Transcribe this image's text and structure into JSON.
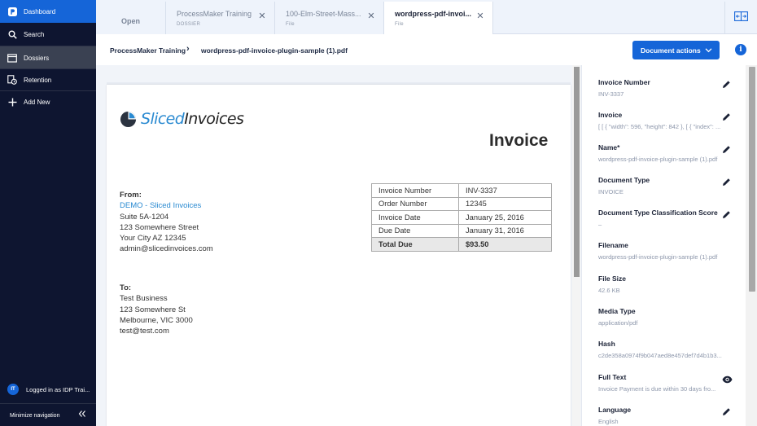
{
  "sidebar": {
    "items": [
      {
        "label": "Dashboard",
        "icon": "app-logo-icon"
      },
      {
        "label": "Search",
        "icon": "search-icon"
      },
      {
        "label": "Dossiers",
        "icon": "folder-icon"
      },
      {
        "label": "Retention",
        "icon": "retention-icon"
      },
      {
        "label": "Add New",
        "icon": "plus-icon"
      }
    ],
    "user_initials": "IT",
    "user_label": "Logged in as IDP Trai...",
    "minimize_label": "Minimize navigation"
  },
  "tabs": {
    "open_label": "Open",
    "items": [
      {
        "title": "ProcessMaker Training",
        "subtitle": "DOSSIER"
      },
      {
        "title": "100-Elm-Street-Mass...",
        "subtitle": "File"
      },
      {
        "title": "wordpress-pdf-invoi...",
        "subtitle": "File"
      }
    ]
  },
  "breadcrumb": {
    "parent": "ProcessMaker Training",
    "separator": "›",
    "current": "wordpress-pdf-invoice-plugin-sample (1).pdf"
  },
  "toolbar": {
    "document_actions_label": "Document actions",
    "info_glyph": "i"
  },
  "document": {
    "logo_word1": "Sliced",
    "logo_word2": "Invoices",
    "heading": "Invoice",
    "from_label": "From:",
    "from_name_demo": "DEMO",
    "from_name_rest": " - Sliced Invoices",
    "from_lines": [
      "Suite 5A-1204",
      "123 Somewhere Street",
      "Your City AZ 12345",
      "admin@slicedinvoices.com"
    ],
    "to_label": "To:",
    "to_lines": [
      "Test Business",
      "123 Somewhere St",
      "Melbourne, VIC 3000",
      "test@test.com"
    ],
    "table": [
      {
        "key": "Invoice Number",
        "value": "INV-3337"
      },
      {
        "key": "Order Number",
        "value": "12345"
      },
      {
        "key": "Invoice Date",
        "value": "January 25, 2016"
      },
      {
        "key": "Due Date",
        "value": "January 31, 2016"
      },
      {
        "key": "Total Due",
        "value": "$93.50"
      }
    ]
  },
  "properties": [
    {
      "label": "Invoice Number",
      "value": "INV-3337",
      "action": "pencil-icon"
    },
    {
      "label": "Invoice",
      "value": "[ [ { \"width\": 596, \"height\": 842 }, [ { \"index\": ...",
      "action": "pencil-icon"
    },
    {
      "label": "Name*",
      "value": "wordpress-pdf-invoice-plugin-sample (1).pdf",
      "action": "pencil-icon"
    },
    {
      "label": "Document Type",
      "value": "INVOICE",
      "action": "pencil-icon"
    },
    {
      "label": "Document Type Classification Score",
      "value": "–",
      "action": "pencil-icon"
    },
    {
      "label": "Filename",
      "value": "wordpress-pdf-invoice-plugin-sample (1).pdf",
      "action": ""
    },
    {
      "label": "File Size",
      "value": "42.6 KB",
      "action": ""
    },
    {
      "label": "Media Type",
      "value": "application/pdf",
      "action": ""
    },
    {
      "label": "Hash",
      "value": "c2de358a0974f9b047aed8e457def7d4b1b3...",
      "action": ""
    },
    {
      "label": "Full Text",
      "value": "Invoice Payment is due within 30 days fro...",
      "action": "eye-icon"
    },
    {
      "label": "Language",
      "value": "English",
      "action": "pencil-icon"
    }
  ],
  "colors": {
    "sidebar_bg": "#0e1530",
    "accent": "#1565d8",
    "logo_blue": "#2a8ad1"
  }
}
